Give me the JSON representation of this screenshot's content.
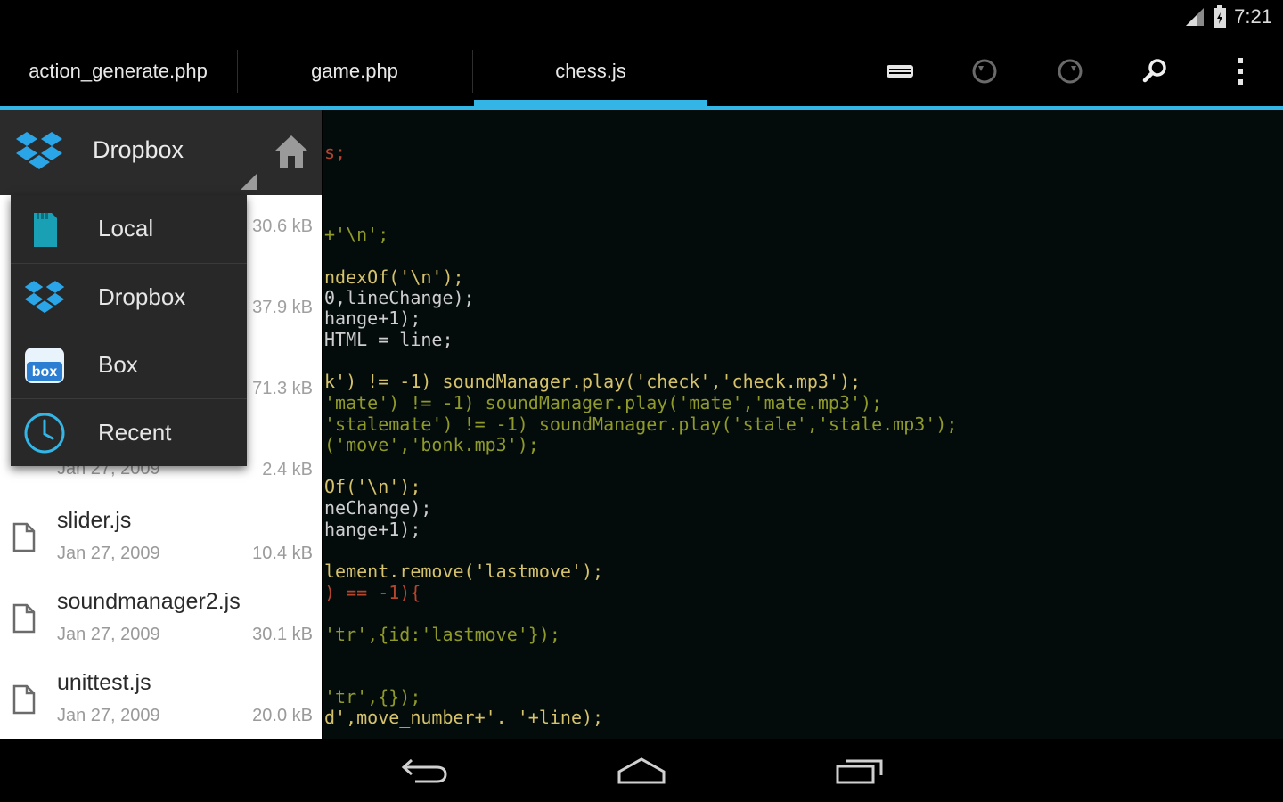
{
  "status_bar": {
    "time": "7:21",
    "icons": [
      "signal-icon",
      "battery-icon"
    ]
  },
  "tabs": [
    {
      "label": "action_generate.php",
      "active": false
    },
    {
      "label": "game.php",
      "active": false
    },
    {
      "label": "chess.js",
      "active": true
    }
  ],
  "actions": [
    "keyboard-icon",
    "undo-icon",
    "redo-icon",
    "search-icon",
    "overflow-menu-icon"
  ],
  "accent_color": "#33b5e5",
  "file_panel": {
    "title": "Dropbox",
    "hidden_sizes": [
      "30.6 kB",
      "37.9 kB",
      "71.3 kB",
      "2.4 kB"
    ],
    "partial_date": "Jan 27, 2009",
    "files": [
      {
        "name": "slider.js",
        "date": "Jan 27, 2009",
        "size": "10.4 kB"
      },
      {
        "name": "soundmanager2.js",
        "date": "Jan 27, 2009",
        "size": "30.1 kB"
      },
      {
        "name": "unittest.js",
        "date": "Jan 27, 2009",
        "size": "20.0 kB"
      }
    ]
  },
  "dropdown": {
    "items": [
      {
        "label": "Local",
        "icon": "sd-card-icon"
      },
      {
        "label": "Dropbox",
        "icon": "dropbox-icon"
      },
      {
        "label": "Box",
        "icon": "box-icon"
      },
      {
        "label": "Recent",
        "icon": "clock-icon"
      }
    ]
  },
  "editor": {
    "lines": [
      "s;",
      "+'\\n';",
      "ndexOf('\\n');",
      "0,lineChange);",
      "hange+1);",
      "HTML = line;",
      "k') != -1) soundManager.play('check','check.mp3');",
      "'mate') != -1) soundManager.play('mate','mate.mp3');",
      "'stalemate') != -1) soundManager.play('stale','stale.mp3');",
      "('move','bonk.mp3');",
      "Of('\\n');",
      "neChange);",
      "hange+1);",
      "lement.remove('lastmove');",
      ") == -1){",
      "'tr',{id:'lastmove'});",
      "'tr',{});",
      "d',move_number+'. '+line);"
    ]
  },
  "nav_bar": [
    "back-icon",
    "home-icon",
    "recent-apps-icon"
  ]
}
